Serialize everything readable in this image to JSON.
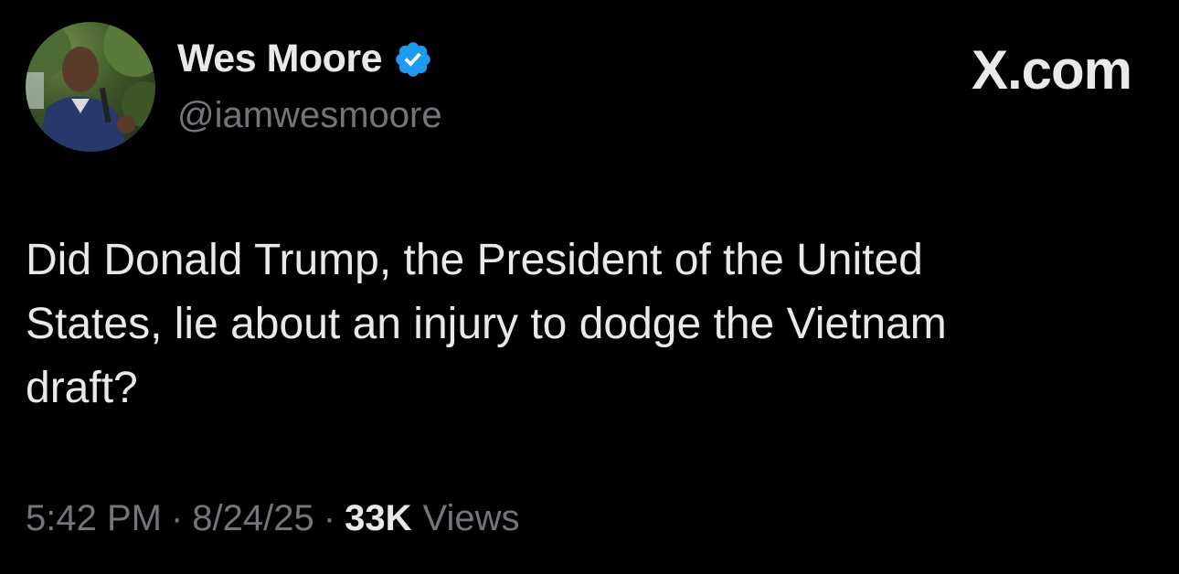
{
  "author": {
    "display_name": "Wes Moore",
    "handle": "@iamwesmoore",
    "verified": true
  },
  "brand": "X.com",
  "tweet": {
    "text": "Did Donald Trump, the President of the United\nStates, lie about an injury to dodge the Vietnam\ndraft?",
    "time": "5:42 PM",
    "date": "8/24/25",
    "separator": "·",
    "views_count": "33K",
    "views_label": "Views"
  },
  "colors": {
    "background": "#000000",
    "text_primary": "#e7e9ea",
    "text_secondary": "#71767b",
    "verified_badge": "#1d9bf0"
  },
  "icons": {
    "verified": "verified-badge-icon"
  }
}
